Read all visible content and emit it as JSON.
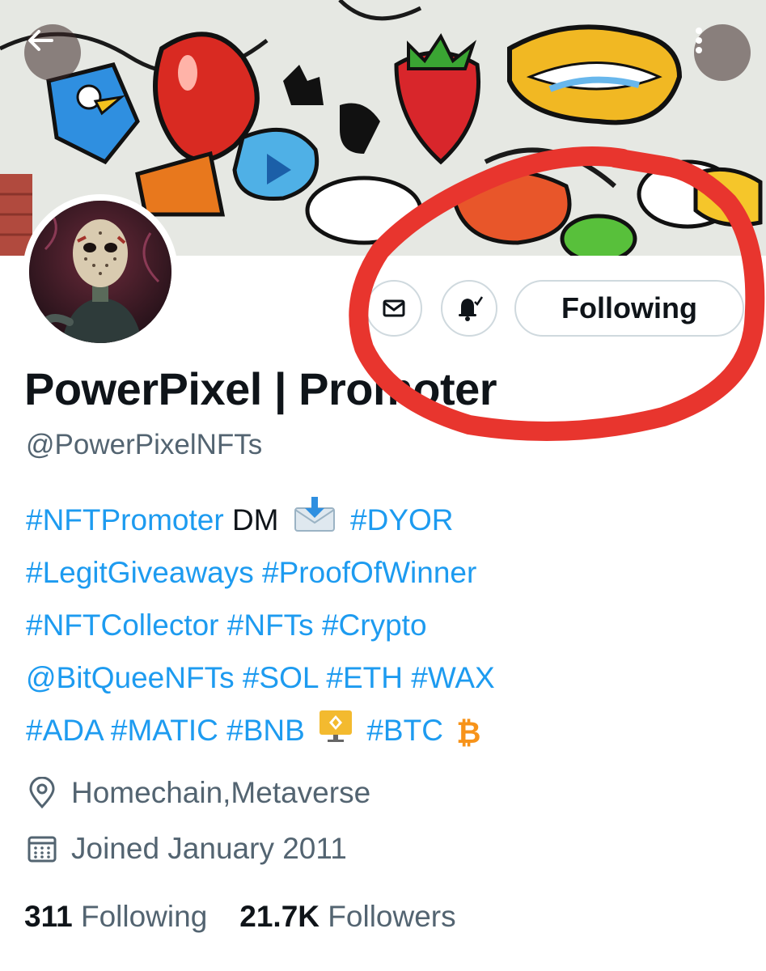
{
  "profile": {
    "display_name": "PowerPixel | Promoter",
    "handle": "@PowerPixelNFTs"
  },
  "actions": {
    "following_label": "Following"
  },
  "bio": {
    "line1": {
      "tag1": "#NFTPromoter",
      "text": "DM",
      "emoji": "envelope-with-arrow-icon",
      "tag2": "#DYOR"
    },
    "line2": {
      "tag1": "#LegitGiveaways",
      "tag2": "#ProofOfWinner"
    },
    "line3": {
      "tag1": "#NFTCollector",
      "tag2": "#NFTs",
      "tag3": "#Crypto"
    },
    "line4": {
      "mention": "@BitQueeNFTs",
      "tag1": "#SOL",
      "tag2": "#ETH",
      "tag3": "#WAX"
    },
    "line5": {
      "tag1": "#ADA",
      "tag2": "#MATIC",
      "tag3": "#BNB",
      "emoji": "bnb-logo-icon",
      "tag4": "#BTC",
      "emoji2": "bitcoin-icon"
    }
  },
  "meta": {
    "location": "Homechain,Metaverse",
    "joined": "Joined January 2011"
  },
  "stats": {
    "following_count": "311",
    "following_label": "Following",
    "followers_count": "21.7K",
    "followers_label": "Followers"
  },
  "colors": {
    "link": "#1d9bf0",
    "text": "#0f1419",
    "secondary": "#536471",
    "annotation": "#e8352e",
    "bitcoin": "#f7931a"
  }
}
